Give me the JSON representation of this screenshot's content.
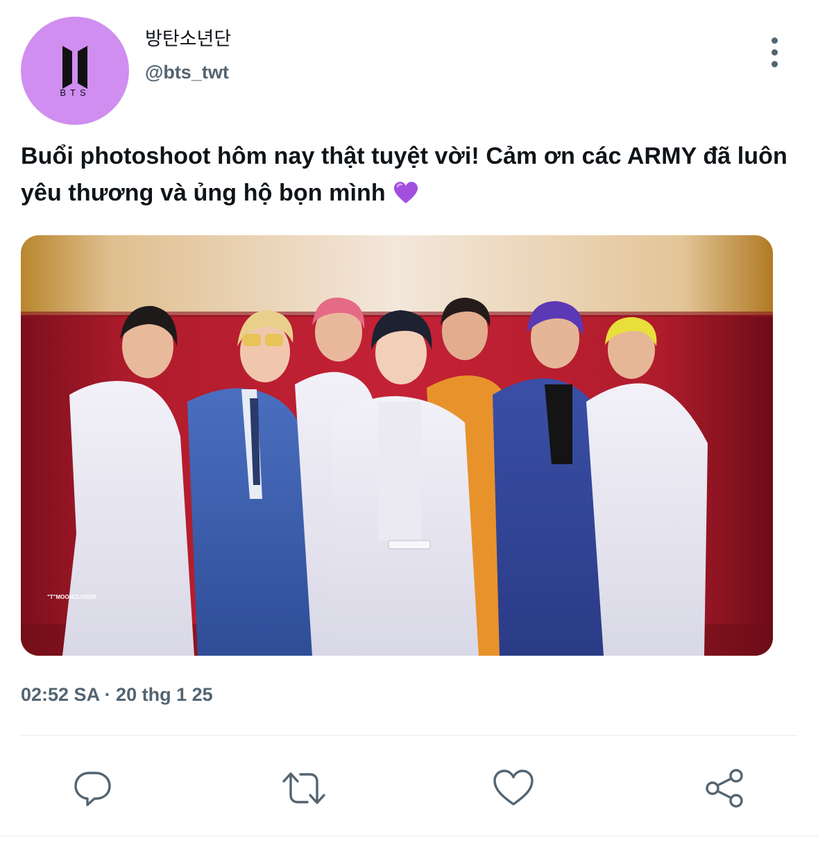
{
  "author": {
    "display_name": "방탄소년단",
    "handle": "@bts_twt",
    "avatar_icon": "bts-logo-icon",
    "avatar_logo_text": "BTS",
    "avatar_color": "#cf8ef0"
  },
  "tweet": {
    "text": "Buổi photoshoot hôm nay thật tuyệt vời! Cảm ơn các ARMY đã luôn yêu thương và ủng hộ bọn mình",
    "emoji": "purple-heart-icon",
    "timestamp": "02:52 SA · 20 thg 1 25",
    "image_caption": "\"T\"MOONCLOSER"
  },
  "actions": [
    {
      "name": "reply",
      "icon": "reply-icon"
    },
    {
      "name": "retweet",
      "icon": "retweet-icon"
    },
    {
      "name": "like",
      "icon": "heart-icon"
    },
    {
      "name": "share",
      "icon": "share-icon"
    }
  ],
  "colors": {
    "text": "#0f1419",
    "secondary": "#536471",
    "divider": "#eff3f4",
    "heart_emoji": "#a24fe0"
  }
}
